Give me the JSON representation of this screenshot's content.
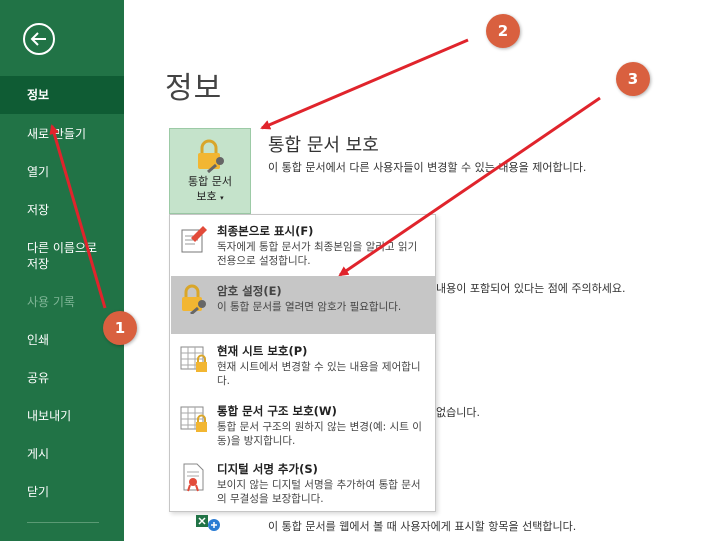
{
  "sidebar": {
    "items": [
      {
        "label": "정보"
      },
      {
        "label": "새로 만들기"
      },
      {
        "label": "열기"
      },
      {
        "label": "저장"
      },
      {
        "label": "다른 이름으로\n저장"
      },
      {
        "label": "사용 기록"
      },
      {
        "label": "인쇄"
      },
      {
        "label": "공유"
      },
      {
        "label": "내보내기"
      },
      {
        "label": "게시"
      },
      {
        "label": "닫기"
      }
    ]
  },
  "main": {
    "title": "정보",
    "protect_button": {
      "line1": "통합 문서",
      "line2": "보호"
    },
    "section_title": "통합 문서 보호",
    "section_desc": "이 통합 문서에서 다른 사용자들이 변경할 수 있는 내용을 제어합니다.",
    "partial_desc_1": "내용이 포함되어 있다는 점에 주의하세요.",
    "partial_desc_2": "없습니다.",
    "bottom_desc": "이 통합 문서를 웹에서 볼 때 사용자에게 표시할 항목을 선택합니다."
  },
  "dropdown": {
    "items": [
      {
        "title": "최종본으로 표시(F)",
        "desc": "독자에게 통합 문서가 최종본임을 알리고 읽기 전용으로 설정합니다."
      },
      {
        "title": "암호 설정(E)",
        "desc": "이 통합 문서를 열려면 암호가 필요합니다."
      },
      {
        "title": "현재 시트 보호(P)",
        "desc": "현재 시트에서 변경할 수 있는 내용을 제어합니다."
      },
      {
        "title": "통합 문서 구조 보호(W)",
        "desc": "통합 문서 구조의 원하지 않는 변경(예: 시트 이동)을 방지합니다."
      },
      {
        "title": "디지털 서명 추가(S)",
        "desc": "보이지 않는 디지털 서명을 추가하여 통합 문서의 무결성을 보장합니다."
      }
    ]
  },
  "annotations": {
    "badges": [
      "1",
      "2",
      "3"
    ]
  },
  "colors": {
    "sidebar": "#217346",
    "active": "#0f5c34",
    "badge": "#d9603f",
    "arrow": "#e0242c",
    "highlight": "#c6c6c6"
  }
}
